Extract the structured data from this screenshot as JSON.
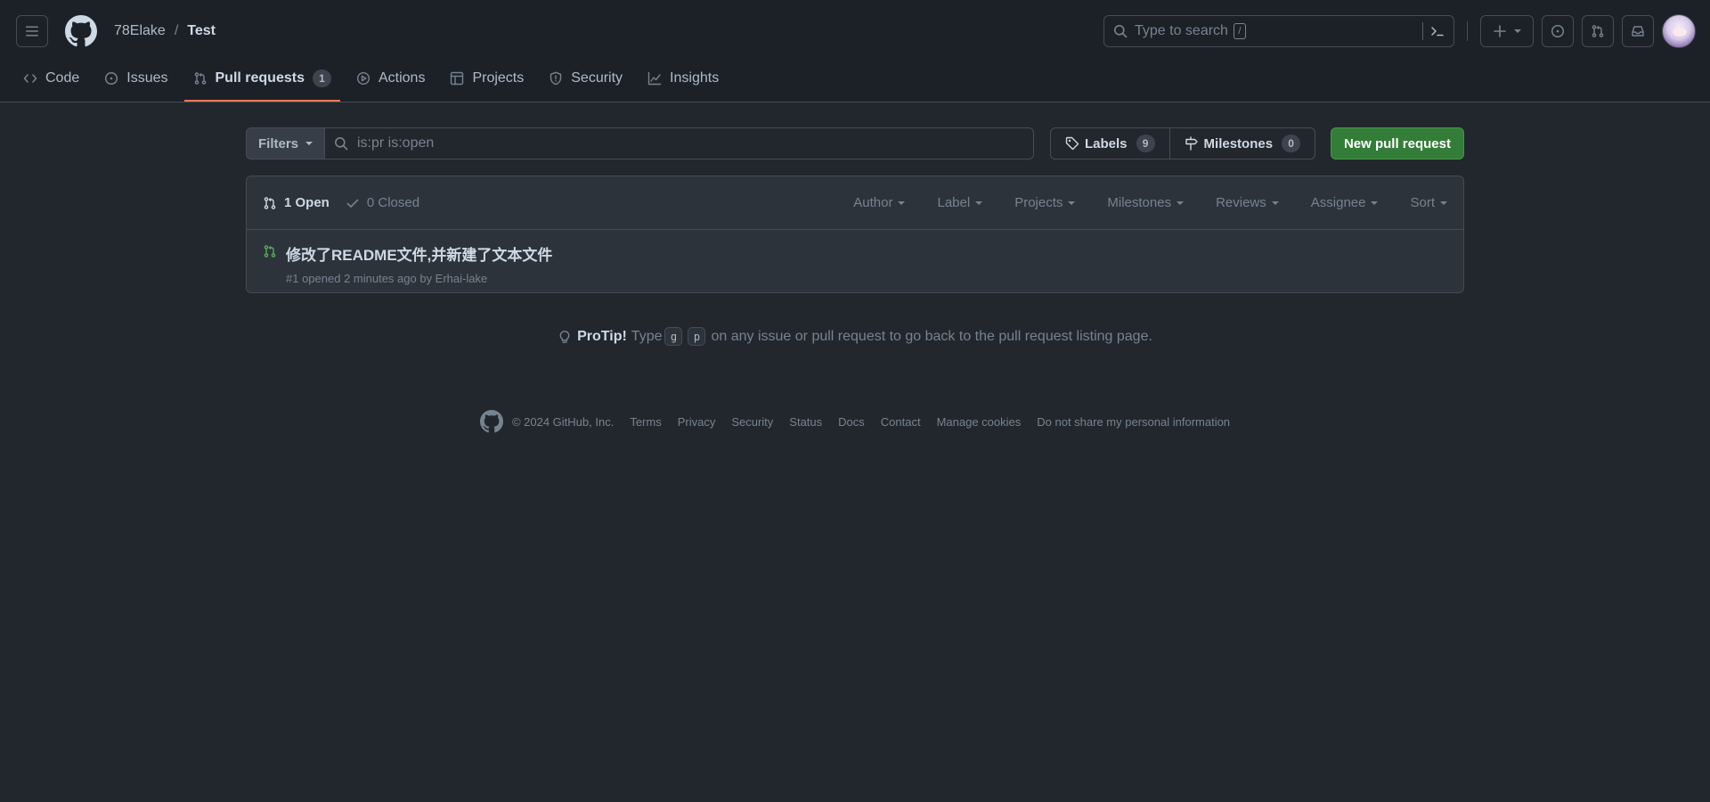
{
  "header": {
    "owner": "78Elake",
    "separator": "/",
    "repo": "Test",
    "search_placeholder": "Type to search",
    "search_shortcut": "/"
  },
  "tabs": [
    {
      "label": "Code",
      "icon": "code-icon"
    },
    {
      "label": "Issues",
      "icon": "issue-opened-icon"
    },
    {
      "label": "Pull requests",
      "icon": "git-pull-request-icon",
      "count": "1",
      "active": true
    },
    {
      "label": "Actions",
      "icon": "play-icon"
    },
    {
      "label": "Projects",
      "icon": "table-icon"
    },
    {
      "label": "Security",
      "icon": "shield-icon"
    },
    {
      "label": "Insights",
      "icon": "graph-icon"
    }
  ],
  "filters": {
    "button_label": "Filters",
    "query": "is:pr is:open",
    "labels_label": "Labels",
    "labels_count": "9",
    "milestones_label": "Milestones",
    "milestones_count": "0",
    "new_pr_label": "New pull request"
  },
  "list": {
    "open_label": "1 Open",
    "closed_label": "0 Closed",
    "sort_menus": [
      "Author",
      "Label",
      "Projects",
      "Milestones",
      "Reviews",
      "Assignee",
      "Sort"
    ],
    "items": [
      {
        "title": "修改了README文件,并新建了文本文件",
        "meta": "#1 opened 2 minutes ago by Erhai-lake"
      }
    ]
  },
  "protip": {
    "label": "ProTip!",
    "before": "Type",
    "key1": "g",
    "key2": "p",
    "after": "on any issue or pull request to go back to the pull request listing page."
  },
  "footer": {
    "copyright": "© 2024 GitHub, Inc.",
    "links": [
      "Terms",
      "Privacy",
      "Security",
      "Status",
      "Docs",
      "Contact",
      "Manage cookies",
      "Do not share my personal information"
    ]
  },
  "colors": {
    "background": "#22272e",
    "header_bg": "#1c2128",
    "accent_underline": "#ec775c",
    "primary_button": "#347d39",
    "open_icon": "#57ab5a"
  }
}
